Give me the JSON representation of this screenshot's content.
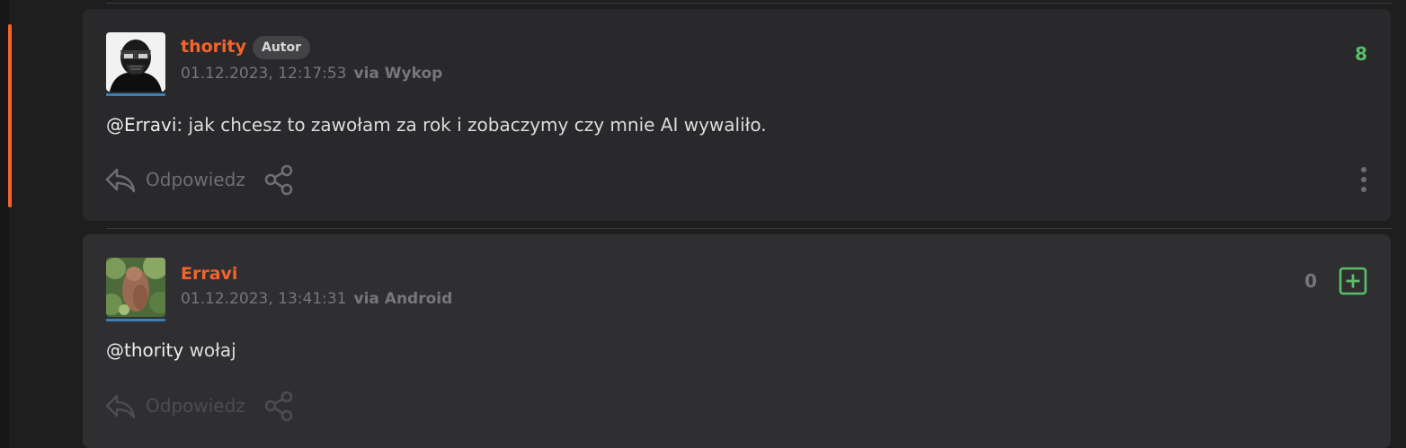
{
  "comments": [
    {
      "author": "thority",
      "badge": "Autor",
      "date": "01.12.2023, 12:17:53",
      "via": "via Wykop",
      "mention": "@Erravi",
      "text": ": jak chcesz to zawołam za rok i zobaczymy czy mnie AI wywaliło.",
      "reply_label": "Odpowiedz",
      "votes": "8",
      "vote_color": "#5bbf6a"
    },
    {
      "author": "Erravi",
      "date": "01.12.2023, 13:41:31",
      "via": "via Android",
      "mention": "@thority",
      "text": " wołaj",
      "reply_label": "Odpowiedz",
      "votes": "0",
      "vote_color": "#77777a"
    }
  ],
  "icons": {
    "reply": "reply-arrow-icon",
    "share": "share-icon",
    "more": "vertical-dots-icon",
    "plus": "plus-box-icon"
  },
  "colors": {
    "accent": "#f4632c",
    "upvote": "#5bbf6a",
    "background": "#1e1e1f"
  }
}
